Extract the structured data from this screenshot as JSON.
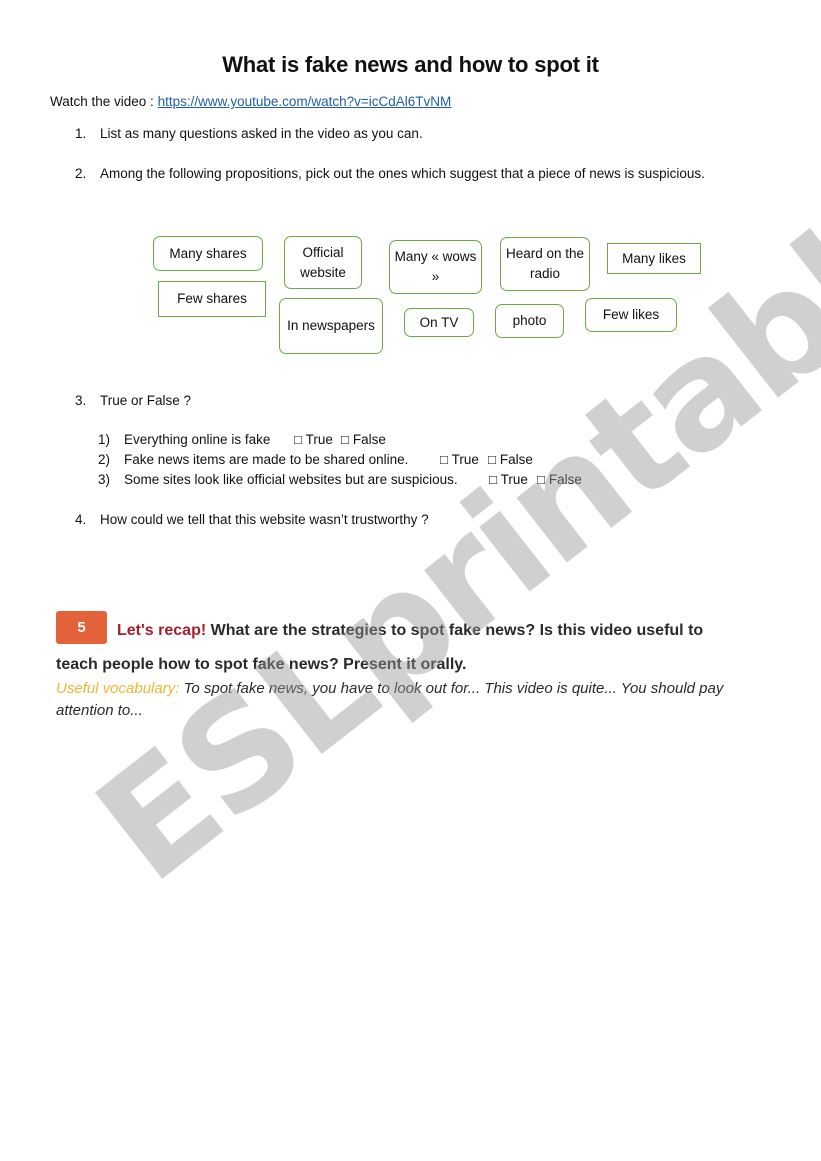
{
  "document": {
    "title": "What is fake news and how to spot it",
    "watch_label": "Watch the video : ",
    "watch_link": "https://www.youtube.com/watch?v=icCdAl6TvNM"
  },
  "questions": [
    {
      "num": "1.",
      "text": "List as many questions asked in the video as you can."
    },
    {
      "num": "2.",
      "text": "Among the following propositions, pick out the ones which suggest that a piece of news is suspicious."
    },
    {
      "num": "3.",
      "text": "True or False ?"
    },
    {
      "num": "4.",
      "text": "How could we tell that this website wasn’t trustworthy ?"
    }
  ],
  "propositions": [
    {
      "label": "Many shares"
    },
    {
      "label": "Few shares"
    },
    {
      "label": "Official website"
    },
    {
      "label": "In newspapers"
    },
    {
      "label": "Many « wows »"
    },
    {
      "label": "On TV"
    },
    {
      "label": "Heard on the radio"
    },
    {
      "label": "photo"
    },
    {
      "label": "Many likes"
    },
    {
      "label": "Few likes"
    }
  ],
  "true_false": [
    {
      "num": "1)",
      "statement": "Everything online is fake",
      "true_label": "□ True",
      "false_label": "□ False"
    },
    {
      "num": "2)",
      "statement": "Fake news items are made to be shared online.",
      "true_label": "□ True",
      "false_label": "□ False"
    },
    {
      "num": "3)",
      "statement": "Some sites look like official websites but are suspicious.",
      "true_label": "□ True",
      "false_label": "□ False"
    }
  ],
  "recap": {
    "badge": "5",
    "lead": "Let's recap!",
    "line1": " What are the strategies to spot fake news? Is this video useful to",
    "line2": "teach people how to spot fake news? Present it orally.",
    "vocab_lead": "Useful vocabulary:",
    "vocab_text": " To spot fake news, you have to look out for... This video is quite... You should pay attention to..."
  },
  "watermark": "ESLprintables.com",
  "colors": {
    "box_border": "#70a847",
    "badge": "#e4623a",
    "recap_lead": "#a8202f",
    "vocab_lead": "#f0b632",
    "link": "#1f5fa8"
  }
}
